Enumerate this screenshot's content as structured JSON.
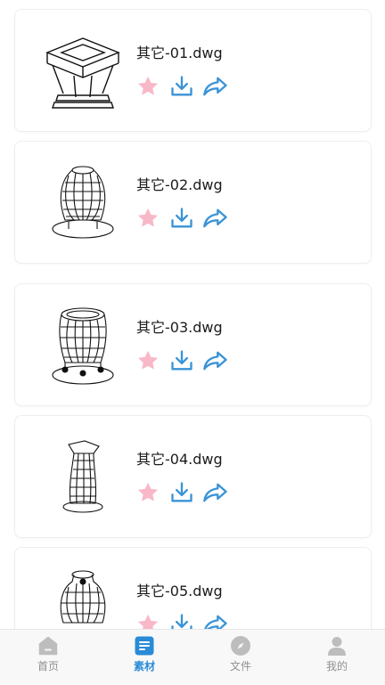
{
  "files": [
    {
      "name": "其它-01.dwg",
      "thumb": "pillar-cap-drawing"
    },
    {
      "name": "其它-02.dwg",
      "thumb": "wireframe-jar-drawing"
    },
    {
      "name": "其它-03.dwg",
      "thumb": "wireframe-pot-drawing"
    },
    {
      "name": "其它-04.dwg",
      "thumb": "wireframe-vase-drawing"
    },
    {
      "name": "其它-05.dwg",
      "thumb": "wireframe-urn-drawing"
    }
  ],
  "actions": {
    "favorite_icon": "star-icon",
    "download_icon": "download-icon",
    "share_icon": "share-icon"
  },
  "tabbar": {
    "tabs": [
      {
        "label": "首页",
        "icon": "home-icon",
        "active": false
      },
      {
        "label": "素材",
        "icon": "materials-icon",
        "active": true
      },
      {
        "label": "文件",
        "icon": "compass-icon",
        "active": false
      },
      {
        "label": "我的",
        "icon": "user-icon",
        "active": false
      }
    ]
  },
  "colors": {
    "star": "#f8b8c8",
    "action_blue": "#3a93d6",
    "tab_active": "#2a8bd6",
    "tab_inactive": "#bdbdbd"
  }
}
